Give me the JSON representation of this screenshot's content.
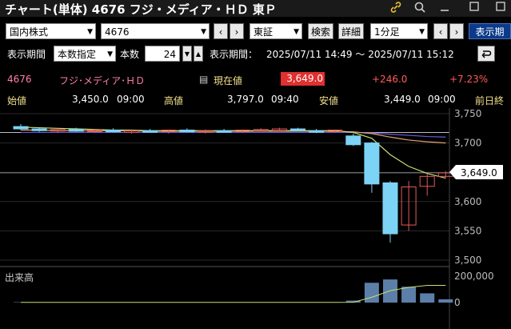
{
  "window": {
    "title": "チャート(単体) 4676 フジ・メディア・ＨＤ 東Ｐ"
  },
  "toolbar": {
    "market": "国内株式",
    "code": "4676",
    "exchange": "東証",
    "search_btn": "検索",
    "detail_btn": "詳細",
    "interval": "1分足",
    "display_btn": "表示期"
  },
  "period": {
    "label": "表示期間",
    "mode": "本数指定",
    "count_label": "本数",
    "count": "24",
    "range_label": "表示期間：",
    "range": "2025/07/11 14:49 ～ 2025/07/11 15:12"
  },
  "quote": {
    "code": "4676",
    "name": "フジ･メディア･ＨＤ",
    "current_label": "現在値",
    "current": "3,649.0",
    "change": "+246.0",
    "change_pct": "+7.23%"
  },
  "ohlc": {
    "open_label": "始値",
    "open": "3,450.0",
    "open_time": "09:00",
    "high_label": "高値",
    "high": "3,797.0",
    "high_time": "09:40",
    "low_label": "安値",
    "low": "3,449.0",
    "low_time": "09:00",
    "prev_label": "前日終"
  },
  "volume_label": "出来高",
  "current_price_tag": "3,649.0",
  "colors": {
    "up": "#e05a5a",
    "down": "#7dd3f5",
    "accent": "#e03030"
  },
  "chart_data": {
    "type": "candlestick",
    "price_axis": {
      "ticks": [
        "3,750",
        "3,700",
        "3,650",
        "3,600",
        "3,550",
        "3,500"
      ],
      "min": 3500,
      "max": 3750
    },
    "volume_axis": {
      "ticks": [
        "200,000",
        "0"
      ],
      "max": 200000
    },
    "candles": [
      {
        "o": 3728,
        "h": 3732,
        "l": 3722,
        "c": 3724
      },
      {
        "o": 3724,
        "h": 3727,
        "l": 3719,
        "c": 3721
      },
      {
        "o": 3721,
        "h": 3725,
        "l": 3717,
        "c": 3723
      },
      {
        "o": 3723,
        "h": 3726,
        "l": 3719,
        "c": 3720
      },
      {
        "o": 3720,
        "h": 3724,
        "l": 3717,
        "c": 3722
      },
      {
        "o": 3722,
        "h": 3725,
        "l": 3718,
        "c": 3719
      },
      {
        "o": 3719,
        "h": 3723,
        "l": 3716,
        "c": 3721
      },
      {
        "o": 3721,
        "h": 3724,
        "l": 3718,
        "c": 3720
      },
      {
        "o": 3720,
        "h": 3723,
        "l": 3716,
        "c": 3722
      },
      {
        "o": 3722,
        "h": 3725,
        "l": 3718,
        "c": 3719
      },
      {
        "o": 3719,
        "h": 3723,
        "l": 3716,
        "c": 3721
      },
      {
        "o": 3721,
        "h": 3724,
        "l": 3718,
        "c": 3720
      },
      {
        "o": 3720,
        "h": 3723,
        "l": 3717,
        "c": 3722
      },
      {
        "o": 3722,
        "h": 3725,
        "l": 3719,
        "c": 3723
      },
      {
        "o": 3723,
        "h": 3726,
        "l": 3719,
        "c": 3724
      },
      {
        "o": 3724,
        "h": 3726,
        "l": 3720,
        "c": 3721
      },
      {
        "o": 3721,
        "h": 3724,
        "l": 3717,
        "c": 3720
      },
      {
        "o": 3720,
        "h": 3723,
        "l": 3717,
        "c": 3722
      },
      {
        "o": 3712,
        "h": 3716,
        "l": 3695,
        "c": 3697
      },
      {
        "o": 3700,
        "h": 3702,
        "l": 3615,
        "c": 3630
      },
      {
        "o": 3632,
        "h": 3635,
        "l": 3530,
        "c": 3545
      },
      {
        "o": 3560,
        "h": 3635,
        "l": 3550,
        "c": 3625
      },
      {
        "o": 3626,
        "h": 3648,
        "l": 3610,
        "c": 3643
      },
      {
        "o": 3643,
        "h": 3652,
        "l": 3640,
        "c": 3649
      }
    ],
    "volumes": [
      3000,
      2000,
      2000,
      2000,
      1500,
      2000,
      1500,
      2000,
      1500,
      2000,
      1500,
      2000,
      1500,
      2000,
      1500,
      2000,
      1500,
      2000,
      15000,
      150000,
      175000,
      120000,
      70000,
      25000
    ],
    "ma_short": [
      3727,
      3726,
      3725,
      3724,
      3723,
      3722,
      3722,
      3721,
      3721,
      3721,
      3721,
      3721,
      3721,
      3721,
      3721,
      3721,
      3721,
      3721,
      3718,
      3708,
      3680,
      3660,
      3648,
      3640
    ],
    "ma_long": [
      3722,
      3722,
      3721,
      3721,
      3721,
      3721,
      3721,
      3720,
      3720,
      3720,
      3720,
      3720,
      3720,
      3720,
      3720,
      3720,
      3720,
      3720,
      3719,
      3716,
      3710,
      3705,
      3702,
      3700
    ],
    "ma_long2": [
      3718,
      3718,
      3718,
      3718,
      3718,
      3718,
      3718,
      3718,
      3718,
      3718,
      3718,
      3718,
      3718,
      3718,
      3718,
      3718,
      3718,
      3718,
      3718,
      3717,
      3715,
      3713,
      3711,
      3710
    ],
    "vol_ma": [
      1800,
      1800,
      1800,
      1800,
      1800,
      1800,
      1800,
      1800,
      1800,
      1800,
      1800,
      1800,
      1800,
      1800,
      1800,
      1800,
      1800,
      1800,
      2500,
      40000,
      90000,
      115000,
      130000,
      130000
    ]
  }
}
